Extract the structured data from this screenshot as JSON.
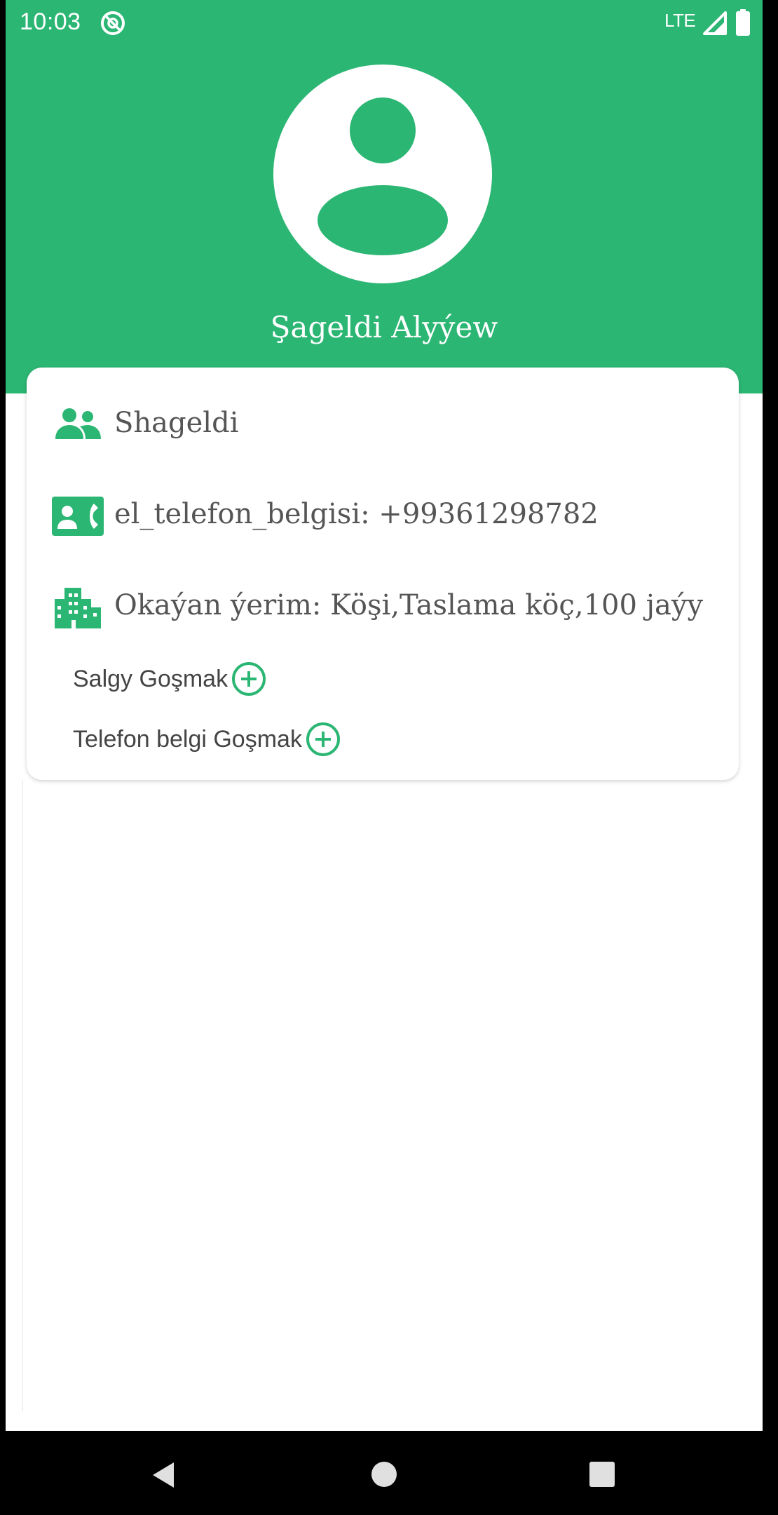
{
  "status_bar": {
    "time": "10:03",
    "network": "LTE",
    "sync_icon": "sync-off-icon",
    "signal_icon": "signal-icon",
    "battery_icon": "battery-icon"
  },
  "colors": {
    "accent": "#2bb673",
    "text_primary": "#555555",
    "text_secondary": "#444444"
  },
  "profile": {
    "avatar_icon": "account-circle-icon",
    "name": "Şageldi Alyýew"
  },
  "card": {
    "rows": [
      {
        "icon": "people-icon",
        "text": "Shageldi"
      },
      {
        "icon": "contact-phone-icon",
        "text": "el_telefon_belgisi: +99361298782"
      },
      {
        "icon": "building-icon",
        "text": "Okaýan ýerim: Köşi,Taslama köç,100 jaýy"
      }
    ],
    "add_address_label": "Salgy Goşmak",
    "add_phone_label": "Telefon belgi Goşmak",
    "add_icon": "add-circle-icon"
  },
  "nav_bar": {
    "back_icon": "back-icon",
    "home_icon": "home-icon",
    "recents_icon": "recents-icon"
  }
}
